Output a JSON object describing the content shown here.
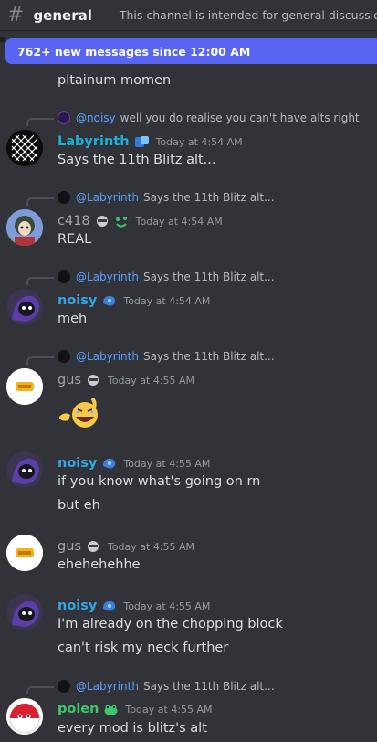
{
  "header": {
    "channel_name": "general",
    "topic": "This channel is intended for general discussions."
  },
  "new_messages_bar": {
    "text": "762+ new messages since 12:00 AM"
  },
  "messages": [
    {
      "text": "pltainum momen"
    },
    {
      "reply": {
        "mention": "@noisy",
        "text": "well you do realise you can't have alts right"
      },
      "author": "Labyrinth",
      "timestamp": "Today at 4:54 AM",
      "text": "Says the 11th Blitz alt..."
    },
    {
      "reply": {
        "mention": "@Labyrinth",
        "text": "Says the 11th Blitz alt..."
      },
      "author": "c418",
      "timestamp": "Today at 4:54 AM",
      "text": "REAL"
    },
    {
      "reply": {
        "mention": "@Labyrinth",
        "text": "Says the 11th Blitz alt..."
      },
      "author": "noisy",
      "timestamp": "Today at 4:54 AM",
      "text": "meh"
    },
    {
      "reply": {
        "mention": "@Labyrinth",
        "text": "Says the 11th Blitz alt..."
      },
      "author": "gus",
      "timestamp": "Today at 4:55 AM",
      "emoji": "pointing-laughing-emoji"
    },
    {
      "author": "noisy",
      "timestamp": "Today at 4:55 AM",
      "lines": [
        "if you know what's going on rn",
        "but eh"
      ]
    },
    {
      "author": "gus",
      "timestamp": "Today at 4:55 AM",
      "text": "ehehehehhe"
    },
    {
      "author": "noisy",
      "timestamp": "Today at 4:55 AM",
      "lines": [
        "I'm already on the chopping block",
        "can't risk my neck further"
      ]
    },
    {
      "reply": {
        "mention": "@Labyrinth",
        "text": "Says the 11th Blitz alt..."
      },
      "author": "polen",
      "timestamp": "Today at 4:55 AM",
      "text": "every mod is blitz's alt"
    }
  ],
  "colors": {
    "background": "#313338",
    "accent_bar": "#5865f2",
    "mention": "#5aa0ff",
    "labyrinth": "#1fb0d8",
    "noisy": "#33a6e3",
    "polen": "#3fc56d"
  }
}
